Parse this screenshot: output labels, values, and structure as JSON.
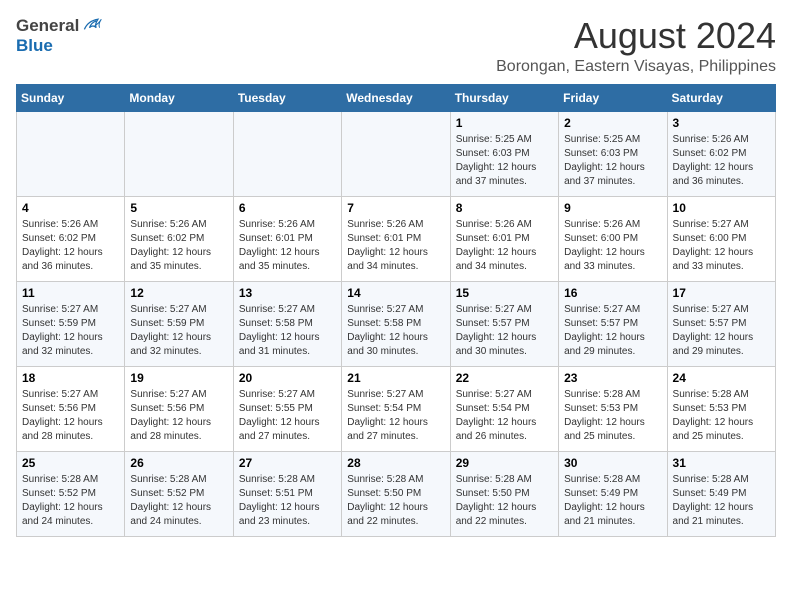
{
  "header": {
    "logo_general": "General",
    "logo_blue": "Blue",
    "title": "August 2024",
    "subtitle": "Borongan, Eastern Visayas, Philippines"
  },
  "days_of_week": [
    "Sunday",
    "Monday",
    "Tuesday",
    "Wednesday",
    "Thursday",
    "Friday",
    "Saturday"
  ],
  "weeks": [
    [
      {
        "day": "",
        "info": ""
      },
      {
        "day": "",
        "info": ""
      },
      {
        "day": "",
        "info": ""
      },
      {
        "day": "",
        "info": ""
      },
      {
        "day": "1",
        "info": "Sunrise: 5:25 AM\nSunset: 6:03 PM\nDaylight: 12 hours\nand 37 minutes."
      },
      {
        "day": "2",
        "info": "Sunrise: 5:25 AM\nSunset: 6:03 PM\nDaylight: 12 hours\nand 37 minutes."
      },
      {
        "day": "3",
        "info": "Sunrise: 5:26 AM\nSunset: 6:02 PM\nDaylight: 12 hours\nand 36 minutes."
      }
    ],
    [
      {
        "day": "4",
        "info": "Sunrise: 5:26 AM\nSunset: 6:02 PM\nDaylight: 12 hours\nand 36 minutes."
      },
      {
        "day": "5",
        "info": "Sunrise: 5:26 AM\nSunset: 6:02 PM\nDaylight: 12 hours\nand 35 minutes."
      },
      {
        "day": "6",
        "info": "Sunrise: 5:26 AM\nSunset: 6:01 PM\nDaylight: 12 hours\nand 35 minutes."
      },
      {
        "day": "7",
        "info": "Sunrise: 5:26 AM\nSunset: 6:01 PM\nDaylight: 12 hours\nand 34 minutes."
      },
      {
        "day": "8",
        "info": "Sunrise: 5:26 AM\nSunset: 6:01 PM\nDaylight: 12 hours\nand 34 minutes."
      },
      {
        "day": "9",
        "info": "Sunrise: 5:26 AM\nSunset: 6:00 PM\nDaylight: 12 hours\nand 33 minutes."
      },
      {
        "day": "10",
        "info": "Sunrise: 5:27 AM\nSunset: 6:00 PM\nDaylight: 12 hours\nand 33 minutes."
      }
    ],
    [
      {
        "day": "11",
        "info": "Sunrise: 5:27 AM\nSunset: 5:59 PM\nDaylight: 12 hours\nand 32 minutes."
      },
      {
        "day": "12",
        "info": "Sunrise: 5:27 AM\nSunset: 5:59 PM\nDaylight: 12 hours\nand 32 minutes."
      },
      {
        "day": "13",
        "info": "Sunrise: 5:27 AM\nSunset: 5:58 PM\nDaylight: 12 hours\nand 31 minutes."
      },
      {
        "day": "14",
        "info": "Sunrise: 5:27 AM\nSunset: 5:58 PM\nDaylight: 12 hours\nand 30 minutes."
      },
      {
        "day": "15",
        "info": "Sunrise: 5:27 AM\nSunset: 5:57 PM\nDaylight: 12 hours\nand 30 minutes."
      },
      {
        "day": "16",
        "info": "Sunrise: 5:27 AM\nSunset: 5:57 PM\nDaylight: 12 hours\nand 29 minutes."
      },
      {
        "day": "17",
        "info": "Sunrise: 5:27 AM\nSunset: 5:57 PM\nDaylight: 12 hours\nand 29 minutes."
      }
    ],
    [
      {
        "day": "18",
        "info": "Sunrise: 5:27 AM\nSunset: 5:56 PM\nDaylight: 12 hours\nand 28 minutes."
      },
      {
        "day": "19",
        "info": "Sunrise: 5:27 AM\nSunset: 5:56 PM\nDaylight: 12 hours\nand 28 minutes."
      },
      {
        "day": "20",
        "info": "Sunrise: 5:27 AM\nSunset: 5:55 PM\nDaylight: 12 hours\nand 27 minutes."
      },
      {
        "day": "21",
        "info": "Sunrise: 5:27 AM\nSunset: 5:54 PM\nDaylight: 12 hours\nand 27 minutes."
      },
      {
        "day": "22",
        "info": "Sunrise: 5:27 AM\nSunset: 5:54 PM\nDaylight: 12 hours\nand 26 minutes."
      },
      {
        "day": "23",
        "info": "Sunrise: 5:28 AM\nSunset: 5:53 PM\nDaylight: 12 hours\nand 25 minutes."
      },
      {
        "day": "24",
        "info": "Sunrise: 5:28 AM\nSunset: 5:53 PM\nDaylight: 12 hours\nand 25 minutes."
      }
    ],
    [
      {
        "day": "25",
        "info": "Sunrise: 5:28 AM\nSunset: 5:52 PM\nDaylight: 12 hours\nand 24 minutes."
      },
      {
        "day": "26",
        "info": "Sunrise: 5:28 AM\nSunset: 5:52 PM\nDaylight: 12 hours\nand 24 minutes."
      },
      {
        "day": "27",
        "info": "Sunrise: 5:28 AM\nSunset: 5:51 PM\nDaylight: 12 hours\nand 23 minutes."
      },
      {
        "day": "28",
        "info": "Sunrise: 5:28 AM\nSunset: 5:50 PM\nDaylight: 12 hours\nand 22 minutes."
      },
      {
        "day": "29",
        "info": "Sunrise: 5:28 AM\nSunset: 5:50 PM\nDaylight: 12 hours\nand 22 minutes."
      },
      {
        "day": "30",
        "info": "Sunrise: 5:28 AM\nSunset: 5:49 PM\nDaylight: 12 hours\nand 21 minutes."
      },
      {
        "day": "31",
        "info": "Sunrise: 5:28 AM\nSunset: 5:49 PM\nDaylight: 12 hours\nand 21 minutes."
      }
    ]
  ]
}
